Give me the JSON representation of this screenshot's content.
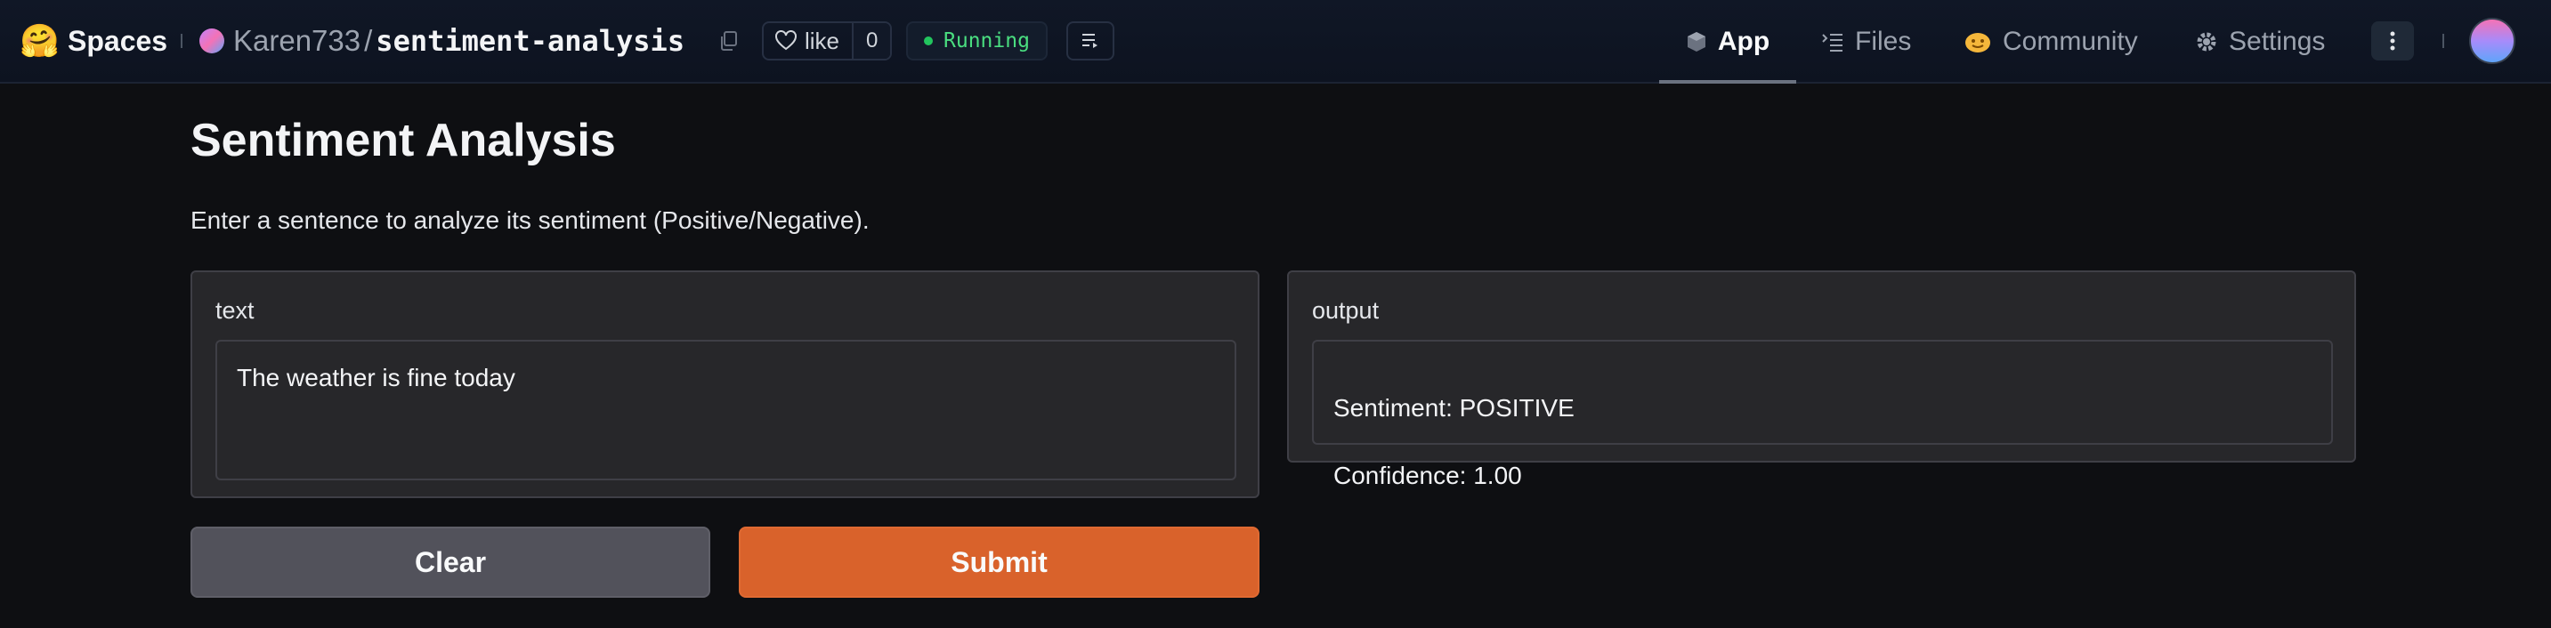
{
  "header": {
    "brand_emoji": "🤗",
    "brand_label": "Spaces",
    "owner": "Karen733",
    "separator": "/",
    "repo_name": "sentiment-analysis",
    "like_label": "like",
    "like_count": "0",
    "status": "Running",
    "tabs": [
      {
        "label": "App",
        "icon": "cube-icon",
        "active": true
      },
      {
        "label": "Files",
        "icon": "files-icon",
        "active": false
      },
      {
        "label": "Community",
        "icon": "community-icon",
        "active": false
      },
      {
        "label": "Settings",
        "icon": "gear-icon",
        "active": false
      }
    ],
    "colors": {
      "status_green": "#4ade80",
      "accent_orange": "#d9622b"
    }
  },
  "app": {
    "title": "Sentiment Analysis",
    "description": "Enter a sentence to analyze its sentiment (Positive/Negative).",
    "input": {
      "label": "text",
      "value": "The weather is fine today"
    },
    "output": {
      "label": "output",
      "line1": "Sentiment: POSITIVE",
      "line2": "Confidence: 1.00"
    },
    "buttons": {
      "clear": "Clear",
      "submit": "Submit"
    }
  }
}
